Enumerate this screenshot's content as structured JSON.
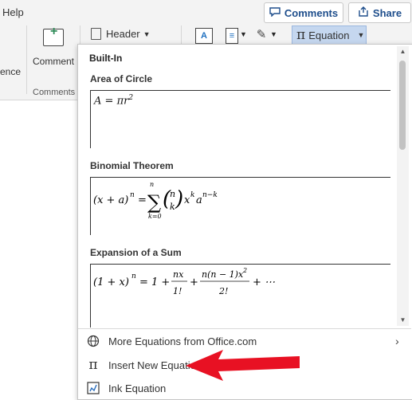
{
  "ribbon": {
    "menu_help": "Help",
    "comments_button": "Comments",
    "share_button": "Share",
    "comment_command": "Comment",
    "comments_group_label": "Comments",
    "partial_label": "ence",
    "header_button": "Header",
    "equation_button": "Equation"
  },
  "equation_gallery": {
    "section_label": "Built-In",
    "items": [
      {
        "title": "Area of Circle",
        "formula": "A = πr²"
      },
      {
        "title": "Binomial Theorem",
        "formula": "(x + a)ⁿ = Σ (n k) xᵏaⁿ⁻ᵏ"
      },
      {
        "title": "Expansion of a Sum",
        "formula": "(1 + x)ⁿ = 1 + nx/1! + n(n − 1)x²/2! + ⋯"
      }
    ]
  },
  "menu": {
    "more_equations": "More Equations from Office.com",
    "insert_new_equation": "Insert New Equation",
    "ink_equation": "Ink Equation"
  },
  "colors": {
    "accent_blue": "#1e4e8c",
    "equation_button_bg": "#c5d7ef",
    "annotation_arrow": "#e81123"
  }
}
